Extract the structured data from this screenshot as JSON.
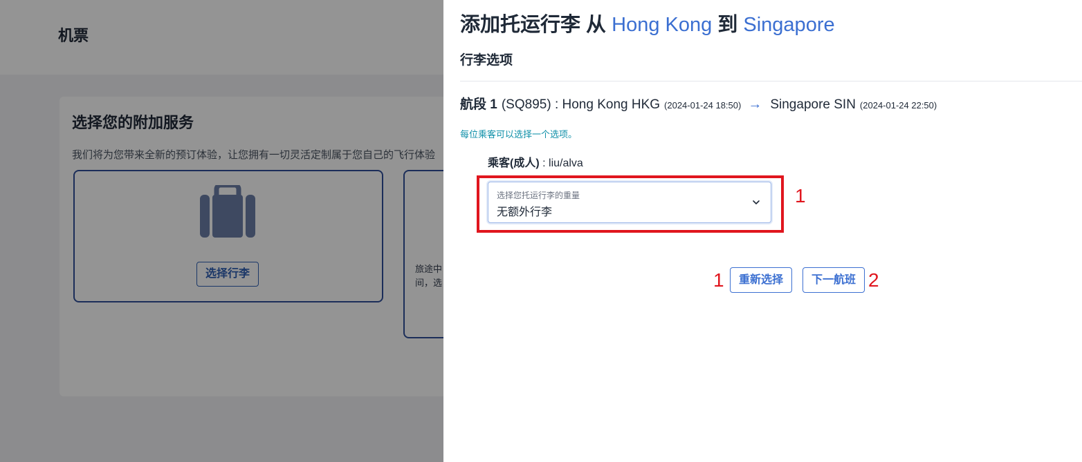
{
  "background": {
    "header_title": "机票",
    "card_title": "选择您的附加服务",
    "card_description": "我们将为您带来全新的预订体验，让您拥有一切灵活定制属于您自己的飞行体验",
    "baggage_button": "选择行李",
    "other_service_text_line1": "旅途中",
    "other_service_text_line2": "间，选"
  },
  "drawer": {
    "title_prefix": "添加托运行李 从",
    "origin": "Hong Kong",
    "title_mid": "到",
    "destination": "Singapore",
    "section_title": "行李选项",
    "segment": {
      "label": "航段 1",
      "flight": "(SQ895) : Hong Kong HKG",
      "depart_time": "(2024-01-24 18:50)",
      "arrow": "→",
      "arrival": "Singapore SIN",
      "arrive_time": "(2024-01-24 22:50)"
    },
    "hint": "每位乘客可以选择一个选项。",
    "passenger": {
      "label": "乘客(成人)",
      "name": ": liu/alva"
    },
    "baggage_select": {
      "label": "选择您托运行李的重量",
      "value": "无额外行李"
    },
    "buttons": {
      "reset": "重新选择",
      "next": "下一航班"
    },
    "annotations": {
      "select_marker": "1",
      "reset_marker": "1",
      "next_marker": "2"
    }
  },
  "colors": {
    "accent": "#3b6fd1",
    "annotation": "#e0161e",
    "hint": "#0e8fa8",
    "service_border": "#2f4f9a"
  }
}
